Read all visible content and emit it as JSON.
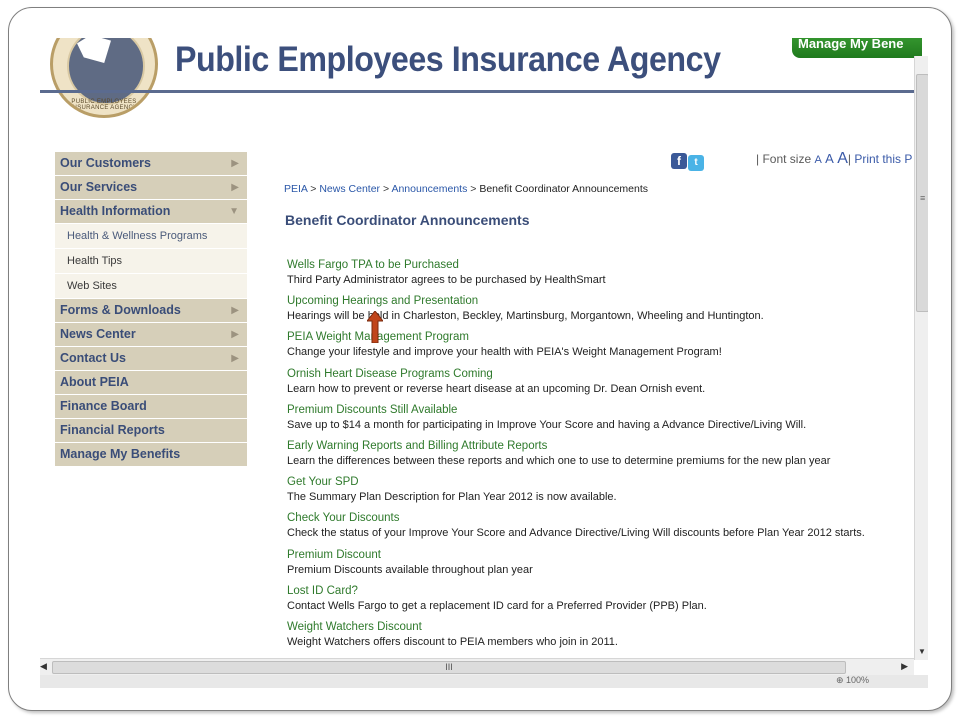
{
  "header": {
    "agency_title": "Public Employees Insurance Agency",
    "seal_text": "PUBLIC EMPLOYEES INSURANCE AGENCY",
    "manage_tab_label": "Manage My Bene"
  },
  "sidebar": {
    "items": [
      {
        "label": "Our Customers",
        "arrow": "▶"
      },
      {
        "label": "Our Services",
        "arrow": "▶"
      },
      {
        "label": "Health Information",
        "arrow": "▼"
      },
      {
        "label": "Forms & Downloads",
        "arrow": "▶"
      },
      {
        "label": "News Center",
        "arrow": "▶"
      },
      {
        "label": "Contact Us",
        "arrow": "▶"
      },
      {
        "label": "About PEIA"
      },
      {
        "label": "Finance Board"
      },
      {
        "label": "Financial Reports"
      },
      {
        "label": "Manage My Benefits"
      }
    ],
    "subitems": [
      {
        "label": "Health & Wellness Programs"
      },
      {
        "label": "Health Tips"
      },
      {
        "label": "Web Sites"
      }
    ]
  },
  "utility": {
    "facebook_icon": "f",
    "twitter_icon": "t",
    "font_size_label": "| Font size",
    "font_small": "A",
    "font_medium": "A",
    "font_large": "A",
    "separator": "|",
    "print_label": "Print this P"
  },
  "breadcrumb": {
    "items": [
      "PEIA",
      "News Center",
      "Announcements",
      "Benefit Coordinator Announcements"
    ],
    "separator": ">"
  },
  "main": {
    "title": "Benefit Coordinator Announcements",
    "announcements": [
      {
        "title": "Wells Fargo TPA to be Purchased",
        "desc": "Third Party Administrator agrees to be purchased by HealthSmart"
      },
      {
        "title": "Upcoming Hearings and Presentation",
        "desc": "Hearings will be held in Charleston, Beckley, Martinsburg, Morgantown, Wheeling and Huntington."
      },
      {
        "title": "PEIA Weight Management Program",
        "desc": "Change your lifestyle and improve your health with PEIA's Weight Management Program!"
      },
      {
        "title": "Ornish Heart Disease Programs Coming",
        "desc": "Learn how to prevent or reverse heart disease at an upcoming Dr. Dean Ornish event."
      },
      {
        "title": "Premium Discounts Still Available",
        "desc": "Save up to $14 a month for participating in Improve Your Score and having a Advance Directive/Living Will."
      },
      {
        "title": "Early Warning Reports and Billing Attribute Reports",
        "desc": "Learn the differences between these reports and which one to use to determine premiums for the new plan year"
      },
      {
        "title": "Get Your SPD",
        "desc": "The Summary Plan Description for Plan Year 2012 is now available."
      },
      {
        "title": "Check Your Discounts",
        "desc": "Check the status of your Improve Your Score and Advance Directive/Living Will discounts before Plan Year 2012 starts."
      },
      {
        "title": "Premium Discount",
        "desc": "Premium Discounts available throughout plan year"
      },
      {
        "title": "Lost ID Card?",
        "desc": "Contact Wells Fargo to get a replacement ID card for a Preferred Provider (PPB) Plan."
      },
      {
        "title": "Weight Watchers Discount",
        "desc": "Weight Watchers offers discount to PEIA members who join in 2011."
      }
    ]
  },
  "scrollbars": {
    "h_grip": "III",
    "h_left_arrow": "◀",
    "h_right_arrow": "▶",
    "v_grip": "≡",
    "v_down_arrow": "▼"
  },
  "status": {
    "text": "⊕ 100%"
  },
  "colors": {
    "title_blue": "#3c4f7c",
    "nav_bg": "#d6cfb9",
    "link_green": "#2f7a2c",
    "manage_green": "#2a8a26",
    "annotation_arrow": "#c0451a"
  },
  "icons": {
    "annotation": "up-arrow-icon"
  }
}
